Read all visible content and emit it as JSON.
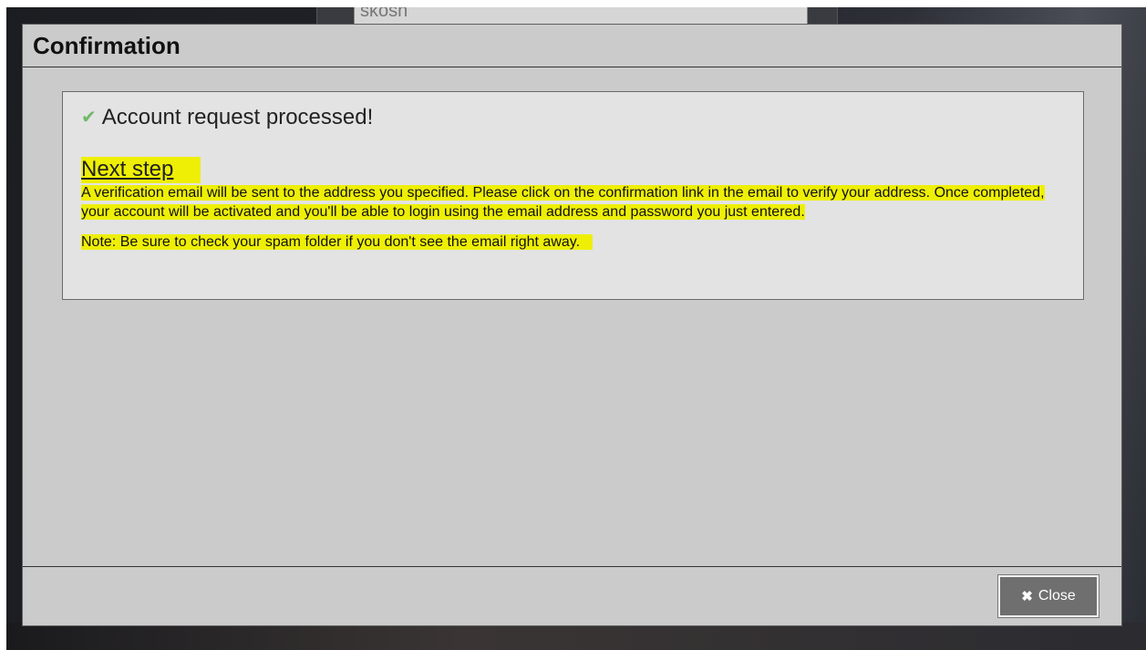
{
  "background": {
    "input_value": "skosh"
  },
  "dialog": {
    "title": "Confirmation",
    "status_icon": "checkmark-icon",
    "status_message": "Account request processed!",
    "next_step_heading": "Next step",
    "instructions": "A verification email will be sent to the address you specified. Please click on the confirmation link in the email to verify your address. Once completed, your account will be activated and you'll be able to login using the email address and password you just entered.",
    "note": "Note: Be sure to check your spam folder if you don't see the email right away.",
    "close_icon": "close-x-icon",
    "close_label": "Close",
    "highlight_color": "#eeef05",
    "check_color": "#6fb86a"
  }
}
